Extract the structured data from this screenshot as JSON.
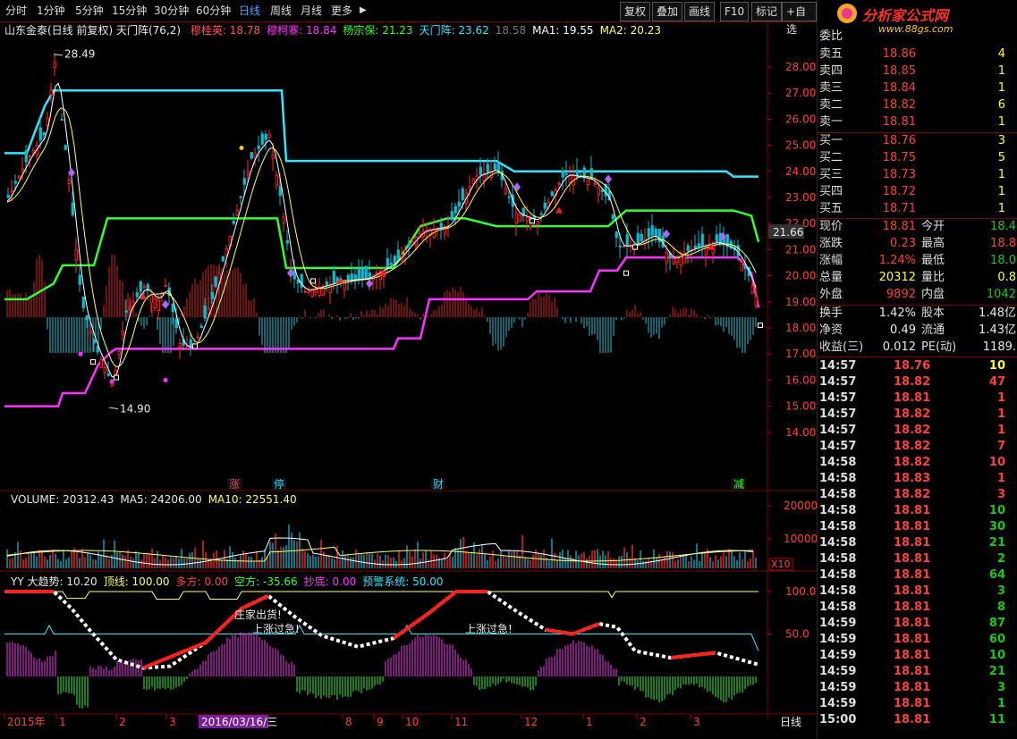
{
  "toolbar": {
    "periods": [
      "分时",
      "1分钟",
      "5分钟",
      "15分钟",
      "30分钟",
      "60分钟",
      "日线",
      "周线",
      "月线",
      "更多"
    ],
    "active_period": "日线",
    "more_arrow": "▶",
    "right_buttons": [
      "复权",
      "叠加",
      "画线",
      "F10",
      "标记",
      "+自选"
    ]
  },
  "logo": {
    "text": "分析家公式网",
    "url": "www.88gs.com"
  },
  "chart_header": {
    "title": "山东金泰(日线 前复权) 天门阵(76,2)",
    "items": [
      {
        "label": "穆桂英: 18.78",
        "color": "#ff5050"
      },
      {
        "label": "穆柯寨: 18.84",
        "color": "#ff33ff"
      },
      {
        "label": "杨宗保: 21.23",
        "color": "#33ff33"
      },
      {
        "label": "天门阵: 23.62",
        "color": "#33e5ff"
      },
      {
        "label": "18.58",
        "color": "#777777"
      },
      {
        "label": "MA1: 19.55",
        "color": "#ffffff"
      },
      {
        "label": "MA2: 20.23",
        "color": "#ffff66"
      }
    ]
  },
  "price_axis": [
    "28.00",
    "27.00",
    "26.00",
    "25.00",
    "24.00",
    "23.00",
    "22.00",
    "21.00",
    "20.00",
    "19.00",
    "18.00",
    "17.00",
    "16.00",
    "15.00",
    "14.00"
  ],
  "current_price_tag": "21.66",
  "annotations": {
    "high": "28.49",
    "low": "14.90"
  },
  "event_markers": [
    {
      "text": "涨",
      "color": "#ff4040"
    },
    {
      "text": "停",
      "color": "#33ccff"
    },
    {
      "text": "财",
      "color": "#33ccff"
    },
    {
      "text": "减",
      "color": "#33ff33"
    }
  ],
  "volume_header": {
    "items": [
      {
        "label": "VOLUME: 20312.43",
        "color": "#e8e8e8"
      },
      {
        "label": "MA5: 24206.00",
        "color": "#e8e8e8"
      },
      {
        "label": "MA10: 22551.40",
        "color": "#ffff66"
      }
    ]
  },
  "volume_axis": [
    "20000",
    "10000",
    "X10"
  ],
  "indicator_header": {
    "items": [
      {
        "label": "YY 大趋势: 10.20",
        "color": "#e8e8e8"
      },
      {
        "label": "顶线: 100.00",
        "color": "#ffff66"
      },
      {
        "label": "多方: 0.00",
        "color": "#ff4040"
      },
      {
        "label": "空方: -35.66",
        "color": "#33ff33"
      },
      {
        "label": "抄底: 0.00",
        "color": "#ff33ff"
      },
      {
        "label": "预警系统: 50.00",
        "color": "#33e5ff"
      }
    ]
  },
  "indicator_axis": [
    "100.0",
    "50.0"
  ],
  "indicator_texts": [
    "庄家出货!",
    "上涨过急!",
    "上涨过急!"
  ],
  "date_axis": {
    "items": [
      "2015年",
      "1",
      "2",
      "3",
      "2016/03/16/三",
      "8",
      "9",
      "10",
      "11",
      "12",
      "1",
      "2",
      "3"
    ],
    "right_label": "日线"
  },
  "quote": {
    "header": "委比",
    "asks": [
      {
        "label": "卖五",
        "price": "18.86",
        "vol": "4"
      },
      {
        "label": "卖四",
        "price": "18.85",
        "vol": "1"
      },
      {
        "label": "卖三",
        "price": "18.84",
        "vol": "1"
      },
      {
        "label": "卖二",
        "price": "18.82",
        "vol": "6"
      },
      {
        "label": "卖一",
        "price": "18.81",
        "vol": "1"
      }
    ],
    "bids": [
      {
        "label": "买一",
        "price": "18.76",
        "vol": "3"
      },
      {
        "label": "买二",
        "price": "18.75",
        "vol": "5"
      },
      {
        "label": "买三",
        "price": "18.73",
        "vol": "1"
      },
      {
        "label": "买四",
        "price": "18.72",
        "vol": "1"
      },
      {
        "label": "买五",
        "price": "18.71",
        "vol": "1"
      }
    ],
    "stats": [
      {
        "l1": "现价",
        "v1": "18.81",
        "c1": "red",
        "l2": "今开",
        "v2": "18.4",
        "c2": "grn"
      },
      {
        "l1": "涨跌",
        "v1": "0.23",
        "c1": "red",
        "l2": "最高",
        "v2": "18.8",
        "c2": "red"
      },
      {
        "l1": "涨幅",
        "v1": "1.24%",
        "c1": "red",
        "l2": "最低",
        "v2": "18.0",
        "c2": "grn"
      },
      {
        "l1": "总量",
        "v1": "20312",
        "c1": "yel",
        "l2": "量比",
        "v2": "0.8",
        "c2": "yel"
      },
      {
        "l1": "外盘",
        "v1": "9892",
        "c1": "red",
        "l2": "内盘",
        "v2": "1042",
        "c2": "grn"
      }
    ],
    "stats2": [
      {
        "l1": "换手",
        "v1": "1.42%",
        "c1": "wht",
        "l2": "股本",
        "v2": "1.48亿",
        "c2": "wht"
      },
      {
        "l1": "净资",
        "v1": "0.49",
        "c1": "wht",
        "l2": "流通",
        "v2": "1.43亿",
        "c2": "wht"
      },
      {
        "l1": "收益(三)",
        "v1": "0.012",
        "c1": "wht",
        "l2": "PE(动)",
        "v2": "1189.",
        "c2": "wht"
      }
    ],
    "ticks": [
      {
        "t": "14:57",
        "p": "18.76",
        "v": "10",
        "vc": "yel"
      },
      {
        "t": "14:57",
        "p": "18.82",
        "v": "47",
        "vc": "red"
      },
      {
        "t": "14:57",
        "p": "18.81",
        "v": "1",
        "vc": "red"
      },
      {
        "t": "14:57",
        "p": "18.82",
        "v": "1",
        "vc": "red"
      },
      {
        "t": "14:57",
        "p": "18.82",
        "v": "1",
        "vc": "red"
      },
      {
        "t": "14:57",
        "p": "18.82",
        "v": "7",
        "vc": "red"
      },
      {
        "t": "14:58",
        "p": "18.82",
        "v": "10",
        "vc": "red"
      },
      {
        "t": "14:58",
        "p": "18.83",
        "v": "1",
        "vc": "red"
      },
      {
        "t": "14:58",
        "p": "18.82",
        "v": "3",
        "vc": "red"
      },
      {
        "t": "14:58",
        "p": "18.81",
        "v": "10",
        "vc": "grn"
      },
      {
        "t": "14:58",
        "p": "18.81",
        "v": "30",
        "vc": "grn"
      },
      {
        "t": "14:58",
        "p": "18.81",
        "v": "21",
        "vc": "grn"
      },
      {
        "t": "14:58",
        "p": "18.81",
        "v": "2",
        "vc": "grn"
      },
      {
        "t": "14:58",
        "p": "18.81",
        "v": "64",
        "vc": "grn"
      },
      {
        "t": "14:58",
        "p": "18.81",
        "v": "3",
        "vc": "grn"
      },
      {
        "t": "14:58",
        "p": "18.81",
        "v": "8",
        "vc": "grn"
      },
      {
        "t": "14:59",
        "p": "18.81",
        "v": "87",
        "vc": "grn"
      },
      {
        "t": "14:59",
        "p": "18.81",
        "v": "60",
        "vc": "grn"
      },
      {
        "t": "14:59",
        "p": "18.81",
        "v": "10",
        "vc": "grn"
      },
      {
        "t": "14:59",
        "p": "18.81",
        "v": "21",
        "vc": "grn"
      },
      {
        "t": "14:59",
        "p": "18.81",
        "v": "3",
        "vc": "grn"
      },
      {
        "t": "14:59",
        "p": "18.81",
        "v": "1",
        "vc": "grn"
      },
      {
        "t": "15:00",
        "p": "18.81",
        "v": "11",
        "vc": "grn"
      }
    ]
  }
}
